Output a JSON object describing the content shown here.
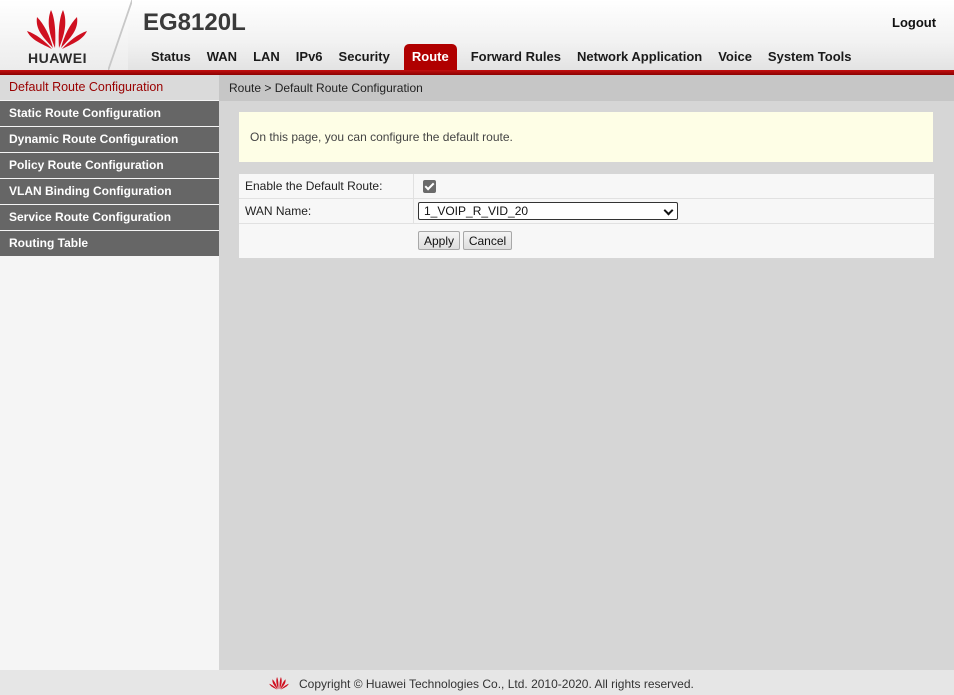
{
  "brand": {
    "logo_text": "HUAWEI",
    "product": "EG8120L",
    "accent": "#c41010"
  },
  "header": {
    "logout": "Logout"
  },
  "nav": [
    "Status",
    "WAN",
    "LAN",
    "IPv6",
    "Security",
    "Route",
    "Forward Rules",
    "Network Application",
    "Voice",
    "System Tools"
  ],
  "nav_active": "Route",
  "sidebar": {
    "items": [
      "Default Route Configuration",
      "Static Route Configuration",
      "Dynamic Route Configuration",
      "Policy Route Configuration",
      "VLAN Binding Configuration",
      "Service Route Configuration",
      "Routing Table"
    ],
    "active": "Default Route Configuration"
  },
  "breadcrumb": "Route > Default Route Configuration",
  "notice": "On this page, you can configure the default route.",
  "form": {
    "enable_label": "Enable the Default Route:",
    "enable_checked": true,
    "wan_label": "WAN Name:",
    "wan_value": "1_VOIP_R_VID_20",
    "apply": "Apply",
    "cancel": "Cancel"
  },
  "footer": {
    "copyright": "Copyright © Huawei Technologies Co., Ltd. 2010-2020. All rights reserved."
  }
}
